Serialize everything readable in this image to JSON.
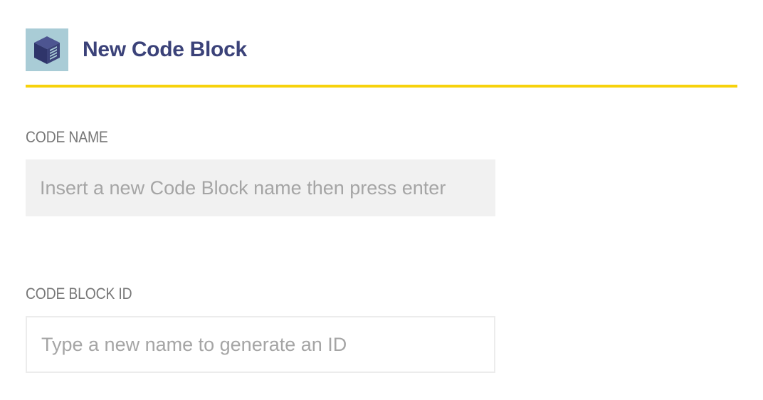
{
  "header": {
    "title": "New Code Block",
    "icon": "cube-icon",
    "accent_color": "#f7d20c",
    "title_color": "#3b4279"
  },
  "form": {
    "code_name": {
      "label": "CODE NAME",
      "placeholder": "Insert a new Code Block name then press enter",
      "value": ""
    },
    "code_block_id": {
      "label": "CODE BLOCK ID",
      "placeholder": "Type a new name to generate an ID",
      "value": ""
    }
  }
}
